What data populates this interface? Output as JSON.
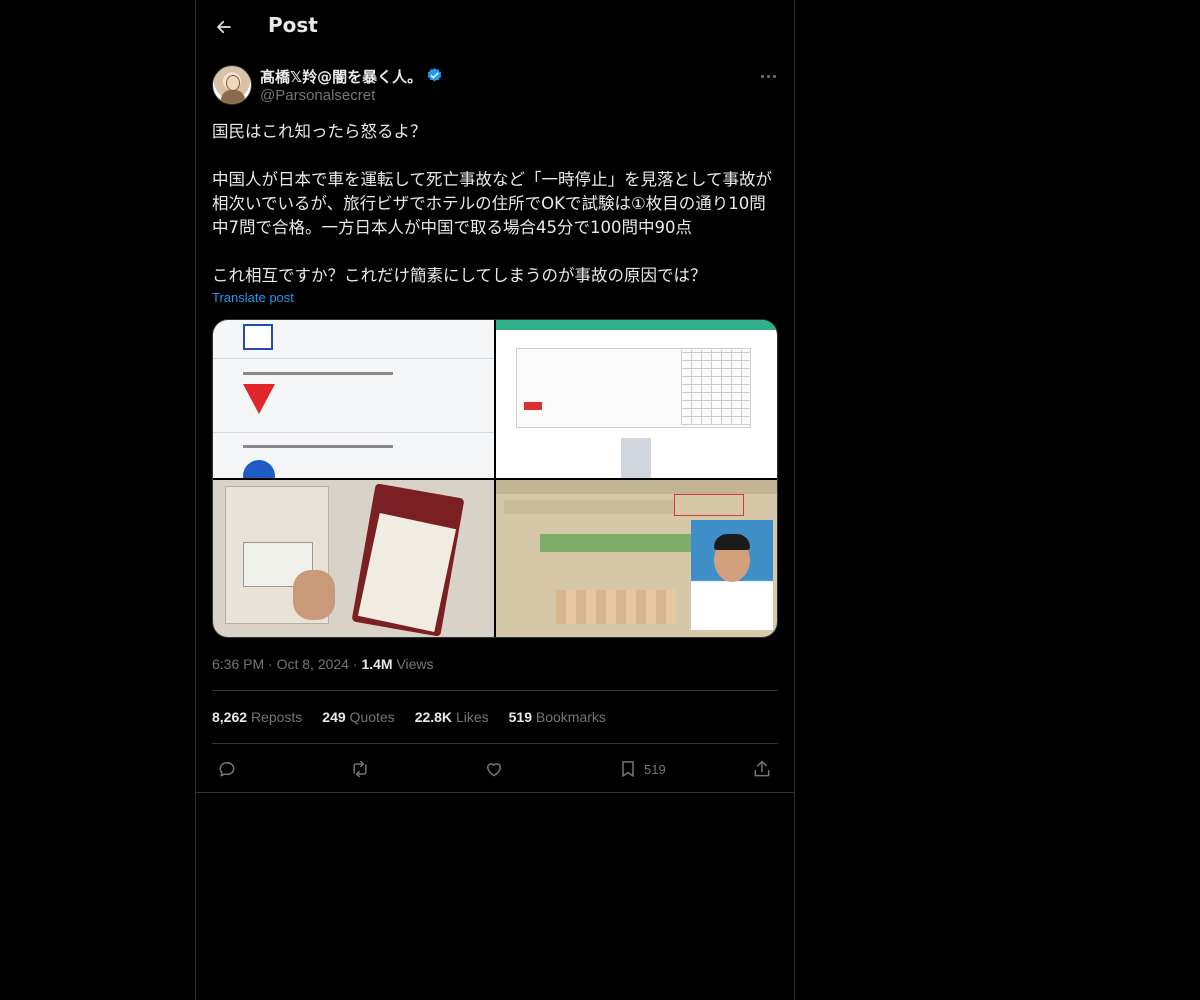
{
  "header": {
    "title": "Post"
  },
  "author": {
    "name": "髙橋𝕏羚@闇を暴く人。",
    "handle": "@Parsonalsecret",
    "verified": true,
    "verified_color": "#1d9bf0"
  },
  "tweet": {
    "paragraphs": [
      "国民はこれ知ったら怒るよ？",
      "中国人が日本で車を運転して死亡事故など「一時停止」を見落として事故が相次いでいるが、旅行ビザでホテルの住所でOKで試験は①枚目の通り10問中7問で合格。一方日本人が中国で取る場合45分で100問中90点",
      "これ相互ですか？これだけ簡素にしてしまうのが事故の原因では？"
    ],
    "translate_label": "Translate post"
  },
  "meta": {
    "time": "6:36 PM",
    "separator": "·",
    "date": "Oct 8, 2024",
    "views_count": "1.4M",
    "views_label": "Views"
  },
  "stats": {
    "reposts": {
      "count": "8,262",
      "label": "Reposts"
    },
    "quotes": {
      "count": "249",
      "label": "Quotes"
    },
    "likes": {
      "count": "22.8K",
      "label": "Likes"
    },
    "bookmarks": {
      "count": "519",
      "label": "Bookmarks"
    }
  },
  "actions": {
    "bookmark_count": "519"
  },
  "colors": {
    "background": "#000000",
    "text_primary": "#e7e9ea",
    "text_secondary": "#71767b",
    "link": "#1d9bf0",
    "border": "#2f3336"
  }
}
